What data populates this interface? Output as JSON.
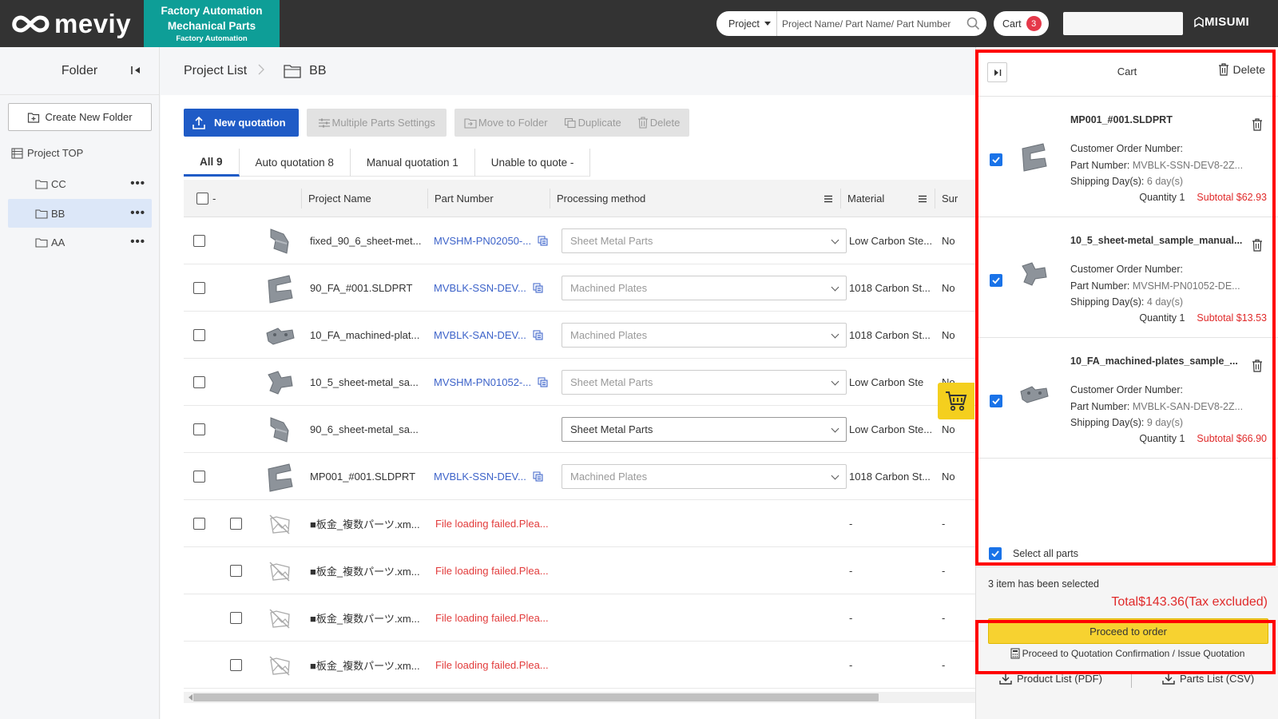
{
  "header": {
    "logo": "meviy",
    "fa_line1": "Factory Automation",
    "fa_line2": "Mechanical Parts",
    "fa_line3": "Factory Automation",
    "search_scope": "Project",
    "search_placeholder": "Project Name/ Part Name/ Part Number",
    "cart_label": "Cart",
    "cart_count": "3",
    "brand": "MISUMI"
  },
  "sidebar": {
    "title": "Folder",
    "create_folder": "Create New Folder",
    "project_top": "Project TOP",
    "folders": [
      {
        "name": "CC",
        "active": false
      },
      {
        "name": "BB",
        "active": true
      },
      {
        "name": "AA",
        "active": false
      }
    ]
  },
  "breadcrumb": {
    "root": "Project List",
    "current": "BB"
  },
  "toolbar": {
    "new_quotation": "New quotation",
    "multiple_parts": "Multiple Parts Settings",
    "move_to_folder": "Move to Folder",
    "duplicate": "Duplicate",
    "delete": "Delete"
  },
  "tabs": [
    {
      "label": "All",
      "count": "9"
    },
    {
      "label": "Auto quotation",
      "count": "8"
    },
    {
      "label": "Manual quotation",
      "count": "1"
    },
    {
      "label": "Unable to quote",
      "count": "-"
    }
  ],
  "table": {
    "select_all_label": "-",
    "columns": {
      "project_name": "Project Name",
      "part_number": "Part Number",
      "processing_method": "Processing method",
      "material": "Material",
      "surface": "Sur"
    },
    "rows": [
      {
        "name": "fixed_90_6_sheet-met...",
        "part": "MVSHM-PN02050-...",
        "method": "Sheet Metal Parts",
        "material": "Low Carbon Ste...",
        "surface": "No"
      },
      {
        "name": "90_FA_#001.SLDPRT",
        "part": "MVBLK-SSN-DEV...",
        "method": "Machined Plates",
        "material": "1018 Carbon St...",
        "surface": "No"
      },
      {
        "name": "10_FA_machined-plat...",
        "part": "MVBLK-SAN-DEV...",
        "method": "Machined Plates",
        "material": "1018 Carbon St...",
        "surface": "No"
      },
      {
        "name": "10_5_sheet-metal_sa...",
        "part": "MVSHM-PN01052-...",
        "method": "Sheet Metal Parts",
        "material": "Low Carbon Ste",
        "surface": "No"
      },
      {
        "name": "90_6_sheet-metal_sa...",
        "part": "",
        "method": "Sheet Metal Parts",
        "material": "Low Carbon Ste...",
        "surface": "No"
      },
      {
        "name": "MP001_#001.SLDPRT",
        "part": "MVBLK-SSN-DEV...",
        "method": "Machined Plates",
        "material": "1018 Carbon St...",
        "surface": "No"
      },
      {
        "name": "■板金_複数パーツ.xm...",
        "part": "File loading failed.Plea...",
        "method": "",
        "material": "-",
        "surface": "-"
      },
      {
        "name": "■板金_複数パーツ.xm...",
        "part": "File loading failed.Plea...",
        "method": "",
        "material": "-",
        "surface": "-"
      },
      {
        "name": "■板金_複数パーツ.xm...",
        "part": "File loading failed.Plea...",
        "method": "",
        "material": "-",
        "surface": "-"
      },
      {
        "name": "■板金_複数パーツ.xm...",
        "part": "File loading failed.Plea...",
        "method": "",
        "material": "-",
        "surface": "-"
      }
    ]
  },
  "cart": {
    "title": "Cart",
    "delete": "Delete",
    "labels": {
      "customer_order": "Customer Order Number:",
      "part_number": "Part Number:",
      "shipping": "Shipping Day(s):",
      "quantity": "Quantity",
      "subtotal": "Subtotal"
    },
    "items": [
      {
        "name": "MP001_#001.SLDPRT",
        "part": "MVBLK-SSN-DEV8-2Z...",
        "days": "6 day(s)",
        "qty": "1",
        "subtotal": "$62.93"
      },
      {
        "name": "10_5_sheet-metal_sample_manual...",
        "part": "MVSHM-PN01052-DE...",
        "days": "4 day(s)",
        "qty": "1",
        "subtotal": "$13.53"
      },
      {
        "name": "10_FA_machined-plates_sample_...",
        "part": "MVBLK-SAN-DEV8-2Z...",
        "days": "9 day(s)",
        "qty": "1",
        "subtotal": "$66.90"
      }
    ],
    "select_all": "Select all parts",
    "selected_text": "3 item has been selected",
    "total": "Total$143.36(Tax excluded)",
    "proceed": "Proceed to order",
    "quotation_link": "Proceed to Quotation Confirmation / Issue Quotation",
    "product_list": "Product List (PDF)",
    "parts_list": "Parts List (CSV)"
  },
  "colors": {
    "header_bg": "#333333",
    "fa_teal": "#0e9e97",
    "primary": "#1f5bc6",
    "accent_yellow": "#f7d230",
    "error_red": "#e23b3b",
    "highlight_red": "#ff0000"
  }
}
